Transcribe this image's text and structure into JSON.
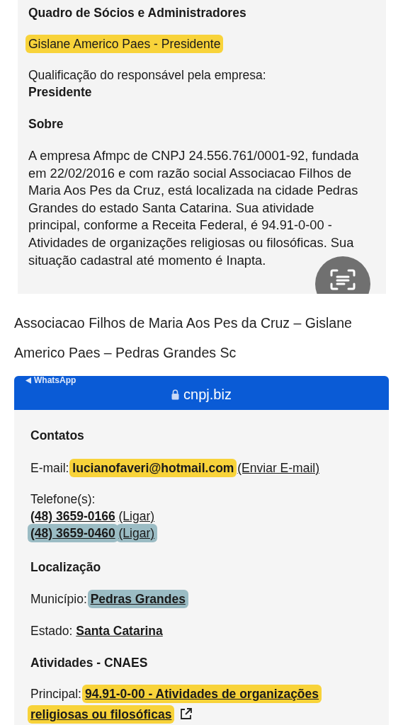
{
  "screenshot_1": {
    "heading": "Quadro de Sócios e Administradores",
    "partner": {
      "text": "Gislane Americo Paes - Presidente",
      "color": "#f8d33a"
    },
    "qualification_label": "Qualificação do responsável pela empresa:",
    "qualification_value": "Presidente",
    "about_heading": "Sobre",
    "about_text": "A empresa Afmpc de CNPJ 24.556.761/0001-92, fundada em 22/02/2016 e com razão social Associacao Filhos de Maria Aos Pes da Cruz, está localizada na cidade Pedras Grandes do estado Santa Catarina. Sua atividade principal, conforme a Receita Federal, é 94.91-0-00 - Atividades de organizações religiosas ou filosóficas. Sua situação cadastral até momento é Inapta."
  },
  "caption": "Associacao Filhos de Maria Aos Pes da Cruz – Gislane Americo Paes – Pedras Grandes Sc",
  "screenshot_2": {
    "back_label": "WhatsApp",
    "domain": "cnpj.biz",
    "contacts_heading": "Contatos",
    "email": {
      "label": "E-mail:",
      "value": "lucianofaveri@hotmail.com",
      "color": "#f8d33a",
      "action": "(Enviar E-mail)"
    },
    "phones_label": "Telefone(s):",
    "phones": [
      {
        "number": "(48) 3659-0166",
        "action": "(Ligar)"
      },
      {
        "number": "(48) 3659-0460",
        "action": "(Ligar)",
        "color": "#9bbcc4"
      }
    ],
    "location_heading": "Localização",
    "location_fields": [
      {
        "label": "Município:",
        "value": "Pedras Grandes",
        "color": "#9bbcc4"
      },
      {
        "label": "Estado:",
        "value": "Santa Catarina"
      }
    ],
    "activities_heading": "Atividades - CNAES",
    "principal": {
      "label": "Principal:",
      "value": "94.91-0-00 - Atividades de organizações religiosas ou filosóficas",
      "color": "#f8d33a"
    }
  }
}
